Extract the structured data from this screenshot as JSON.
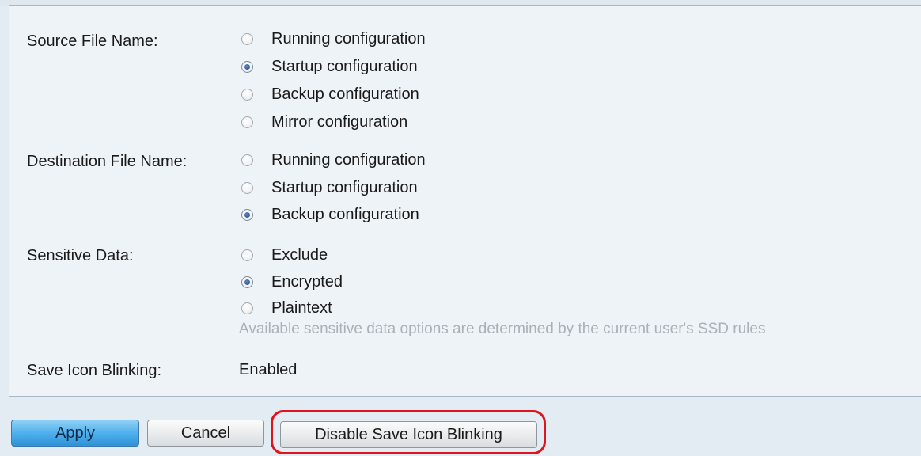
{
  "form": {
    "source": {
      "label": "Source File Name:",
      "options": [
        {
          "label": "Running configuration",
          "checked": false
        },
        {
          "label": "Startup configuration",
          "checked": true
        },
        {
          "label": "Backup configuration",
          "checked": false
        },
        {
          "label": "Mirror configuration",
          "checked": false
        }
      ]
    },
    "destination": {
      "label": "Destination File Name:",
      "options": [
        {
          "label": "Running configuration",
          "checked": false
        },
        {
          "label": "Startup configuration",
          "checked": false
        },
        {
          "label": "Backup configuration",
          "checked": true
        }
      ]
    },
    "sensitive": {
      "label": "Sensitive Data:",
      "options": [
        {
          "label": "Exclude",
          "checked": false
        },
        {
          "label": "Encrypted",
          "checked": true
        },
        {
          "label": "Plaintext",
          "checked": false
        }
      ],
      "hint": "Available sensitive data options are determined by the current user's SSD rules"
    },
    "save_icon_blinking": {
      "label": "Save Icon Blinking:",
      "value": "Enabled"
    }
  },
  "buttons": {
    "apply": "Apply",
    "cancel": "Cancel",
    "disable_blinking": "Disable Save Icon Blinking"
  },
  "colors": {
    "highlight": "#e0151b",
    "apply_button": "#4fb0ec"
  }
}
